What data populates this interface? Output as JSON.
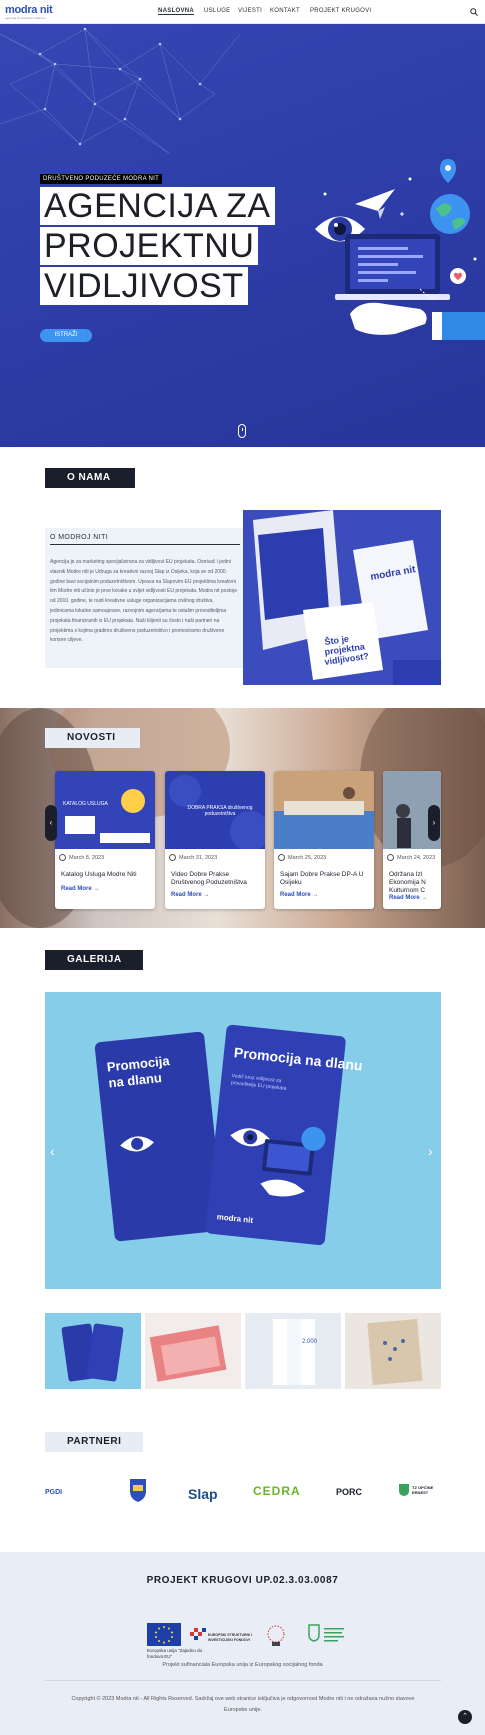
{
  "header": {
    "logo": "modra nit",
    "logo_tagline": "agencija za projektnu vidljivost",
    "nav": [
      "NASLOVNA",
      "USLUGE",
      "VIJESTI",
      "KONTAKT",
      "PROJEKT KRUGOVI"
    ],
    "active_nav": "NASLOVNA"
  },
  "hero": {
    "kicker": "DRUŠTVENO PODUZEĆE MODRA NIT",
    "title_lines": [
      "AGENCIJA ZA",
      "PROJEKTNU",
      "VIDLJIVOST"
    ],
    "button": "ISTRAŽI"
  },
  "onama": {
    "title": "O NAMA",
    "box_title": "O MODROJ NITI",
    "text": "Agencija je za marketing specijalizirana za vidljivost EU projekata. Osnivač i jedini vlasnik Modre niti je Udruga za kreativni razvoj Slap iz Osijeka, koja se od 2000. godine bavi socijalnim poduzetništvom. Uprava na Slapovim EU projektima kreativni tim Modre niti učinio je prve korake u svijet vidljivosti EU projekata. Modra nit postoje od 2010. godine, te nudi kreativne usluge organizacijama civilnog društva, jedinicama lokalne samouprave, razvojnim agencijama te ostalim provoditeljima projekata financiranih iz EU projekata. Naši klijenti su često i naši partneri na projektima s kojima gradimo društveno poduzetništvo i promoviramo društvene korisne ciljeve.",
    "image_text": "Što je projektna vidljivost?",
    "image_brand": "modra nit"
  },
  "novosti": {
    "title": "NOVOSTI",
    "read_more": "Read More",
    "cards": [
      {
        "date": "March 8, 2023",
        "title": "Katalog Usluga Modre Niti",
        "img_label": "KATALOG USLUGA"
      },
      {
        "date": "March 31, 2023",
        "title": "Video Dobre Prakse Društvenog Poduzetništva",
        "img_label": "DOBRA PRAKSA društvenog poduzetništva"
      },
      {
        "date": "March 25, 2023",
        "title": "Sajam Dobre Prakse DP-A U Osijeku",
        "img_label": ""
      },
      {
        "date": "March 24, 2023",
        "title": "Održana Izl Ekonomija N Kulturnom C",
        "img_label": ""
      }
    ]
  },
  "galerija": {
    "title": "GALERIJA",
    "book_title": "Promocija na dlanu",
    "book_sub": "Vodič kroz vidljivost za provoditelje EU projekata",
    "book_brand": "modra nit",
    "thumb_text": "2.000"
  },
  "partneri": {
    "title": "PARTNERI",
    "logos": [
      "PGDI",
      "",
      "Slap",
      "CEDRA",
      "PORC",
      "TZ OPĆINE ERNEST"
    ]
  },
  "footer": {
    "project": "PROJEKT KRUGOVI UP.02.3.03.0087",
    "eu_caption": "Europska unija \"Zajedno do fondova EU\"",
    "esf_label": "EUROPSKI STRUKTURNI I INVESTICIJSKI FONDOVI",
    "funding": "Projekt sufinanciala Europska unija iz Europskog socijalnog fonda",
    "copyright": "Copyright © 2023 Modra nit - All Rights Reserved. Sadržaj ove web stranice isključiva je odgovornost Modre niti i ne odražava nužno stavove Europske unije."
  },
  "colors": {
    "hero_bg": "#2f40aa",
    "accent": "#3e93f0",
    "brand": "#2c4fb8",
    "dark": "#1b1f2b"
  }
}
